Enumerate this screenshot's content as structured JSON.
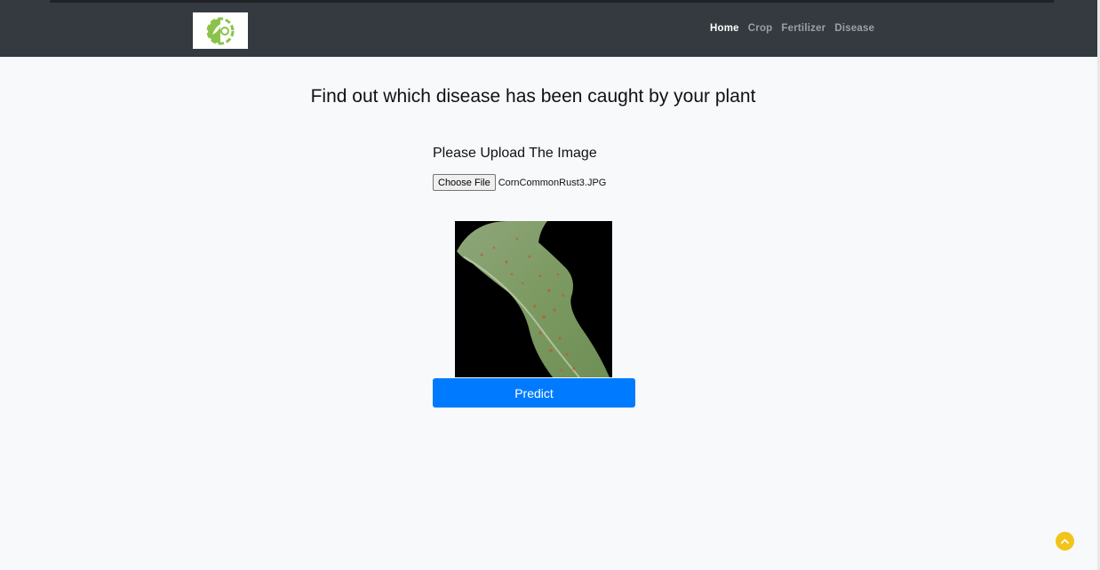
{
  "nav": {
    "logo_icon": "leaf-gear-logo",
    "links": [
      {
        "label": "Home",
        "active": true
      },
      {
        "label": "Crop",
        "active": false
      },
      {
        "label": "Fertilizer",
        "active": false
      },
      {
        "label": "Disease",
        "active": false
      }
    ]
  },
  "main": {
    "title": "Find out which disease has been caught by your plant",
    "upload_label": "Please Upload The Image",
    "choose_file_label": "Choose File",
    "file_name": "CornCommonRust3.JPG",
    "predict_label": "Predict"
  },
  "scroll_top_icon": "chevron-up-icon",
  "colors": {
    "navbar": "#343a40",
    "accent": "#007bff",
    "scroll_button": "#f0c419"
  }
}
